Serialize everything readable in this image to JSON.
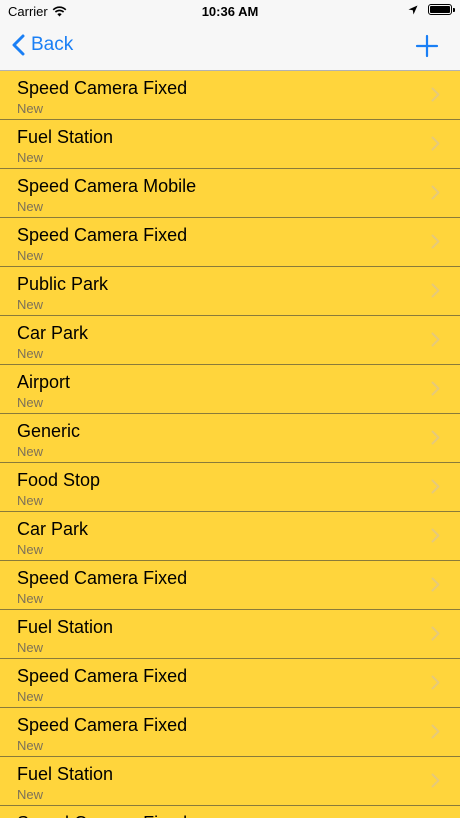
{
  "status_bar": {
    "carrier": "Carrier",
    "time": "10:36 AM",
    "icons": [
      "wifi-icon",
      "location-arrow-icon",
      "battery-icon"
    ],
    "battery_level_percent": 100
  },
  "nav_bar": {
    "back_label": "Back",
    "add_icon": "plus-icon"
  },
  "colors": {
    "row_background": "#ffd53c",
    "accent": "#1a7ff5",
    "subtitle": "#7d7158"
  },
  "list": {
    "items": [
      {
        "title": "Speed Camera Fixed",
        "subtitle": "New"
      },
      {
        "title": "Fuel Station",
        "subtitle": "New"
      },
      {
        "title": "Speed Camera Mobile",
        "subtitle": "New"
      },
      {
        "title": "Speed Camera Fixed",
        "subtitle": "New"
      },
      {
        "title": "Public Park",
        "subtitle": "New"
      },
      {
        "title": "Car Park",
        "subtitle": "New"
      },
      {
        "title": "Airport",
        "subtitle": "New"
      },
      {
        "title": "Generic",
        "subtitle": "New"
      },
      {
        "title": "Food Stop",
        "subtitle": "New"
      },
      {
        "title": "Car Park",
        "subtitle": "New"
      },
      {
        "title": "Speed Camera Fixed",
        "subtitle": "New"
      },
      {
        "title": "Fuel Station",
        "subtitle": "New"
      },
      {
        "title": "Speed Camera Fixed",
        "subtitle": "New"
      },
      {
        "title": "Speed Camera Fixed",
        "subtitle": "New"
      },
      {
        "title": "Fuel Station",
        "subtitle": "New"
      },
      {
        "title": "Speed Camera Fixed",
        "subtitle": ""
      }
    ]
  }
}
